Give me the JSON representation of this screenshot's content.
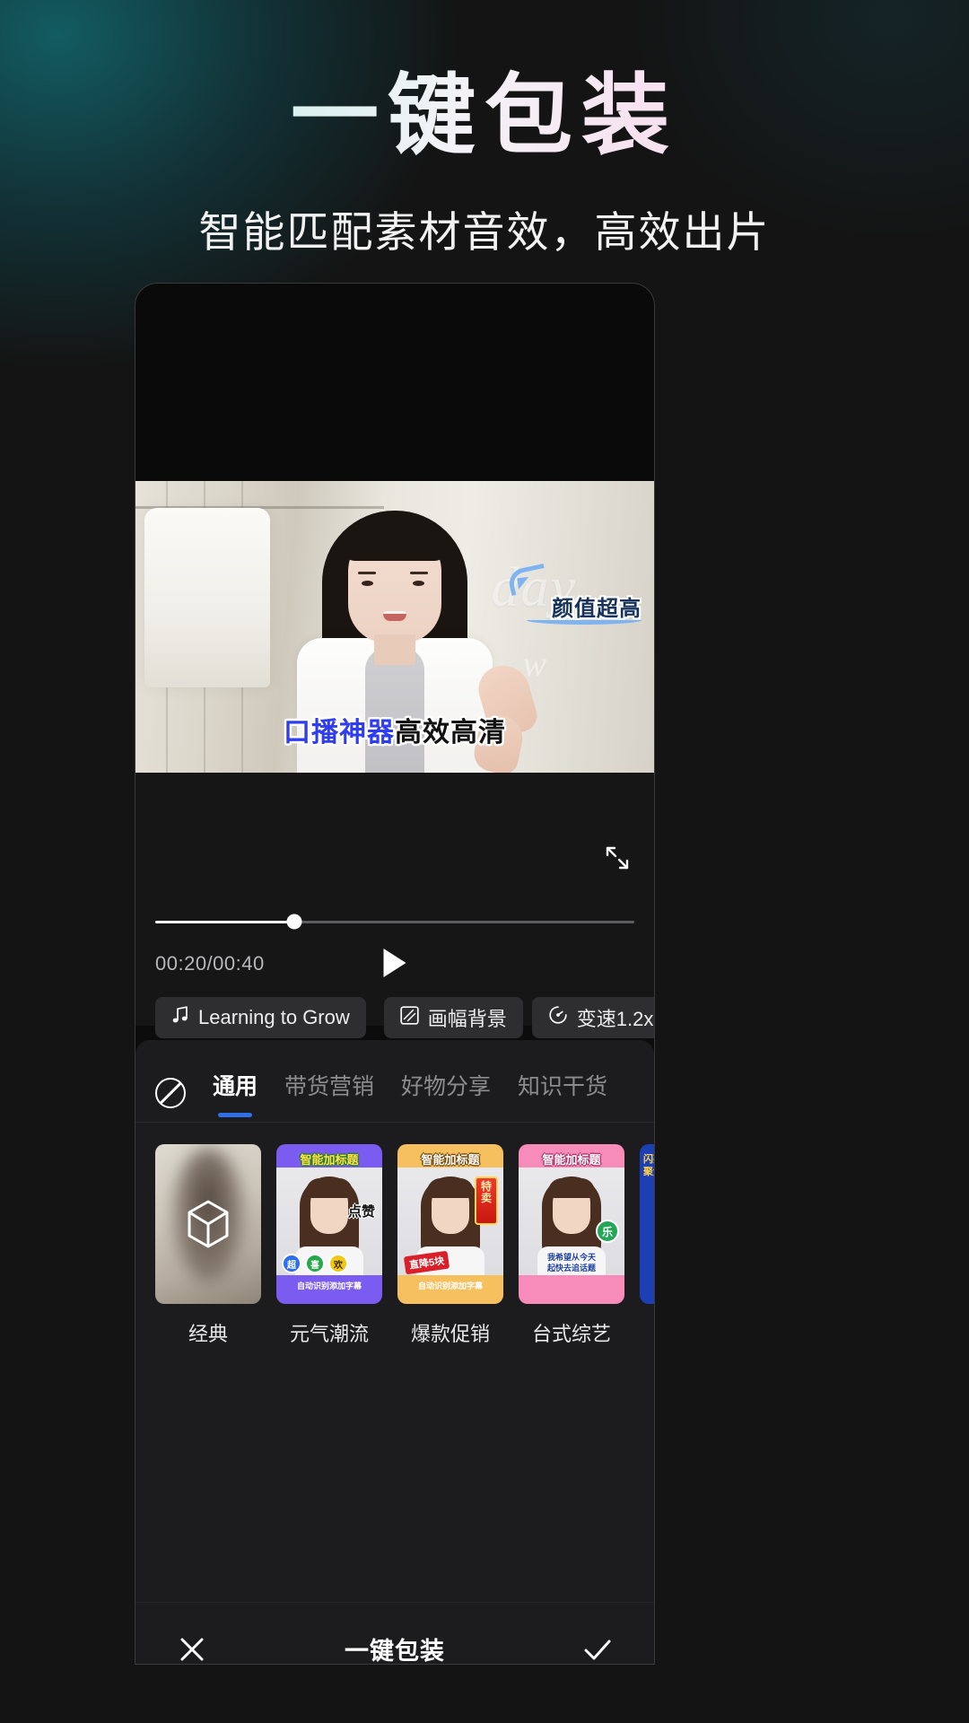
{
  "hero": {
    "title": "一键包装",
    "subtitle": "智能匹配素材音效，高效出片",
    "gradient_start": "#a8eee4",
    "gradient_end": "#f8c6e4"
  },
  "video": {
    "callout_sticker": "颜值超高",
    "subtitle_highlight": "口播神器",
    "subtitle_normal": "高效高清",
    "highlight_color": "#2f3df0",
    "watermark_1": "day",
    "watermark_2": "w"
  },
  "player": {
    "expand_icon": "expand-icon",
    "current_time": "00:20",
    "separator": "/",
    "total_time": "00:40",
    "time_display": "00:20/00:40",
    "progress_percent": 29,
    "play_icon": "play-icon",
    "chips": [
      {
        "icon": "music-note-icon",
        "label": "Learning to Grow"
      },
      {
        "icon": "aspect-ratio-icon",
        "label": "画幅背景"
      },
      {
        "icon": "speed-gauge-icon",
        "label": "变速1.2x"
      }
    ]
  },
  "panel": {
    "none_icon": "no-template-icon",
    "tabs": [
      {
        "label": "通用",
        "active": true
      },
      {
        "label": "带货营销",
        "active": false
      },
      {
        "label": "好物分享",
        "active": false
      },
      {
        "label": "知识干货",
        "active": false
      }
    ],
    "active_tab_color": "#2f6fe8",
    "templates": [
      {
        "label": "经典",
        "style": "classic",
        "top_title": "",
        "bottom_text": "",
        "overlay_icon": "cube-icon"
      },
      {
        "label": "元气潮流",
        "style": "purple",
        "bg": "#7b5cf0",
        "top_title": "智能加标题",
        "sticker_right": "点赞",
        "badges": [
          "超",
          "喜",
          "欢"
        ],
        "bottom_text": "自动识别添加字幕"
      },
      {
        "label": "爆款促销",
        "style": "orange",
        "bg": "#f7c05f",
        "top_title": "智能加标题",
        "sale_tag": "特卖",
        "price_tag": "直降5块",
        "bottom_text": "自动识别添加字幕"
      },
      {
        "label": "台式综艺",
        "style": "pink",
        "bg": "#f78cba",
        "top_title": "智能加标题",
        "badge_right": "乐",
        "lines": "我希望从今天\n起快去追话题"
      },
      {
        "label": "",
        "style": "blue",
        "bg": "#1d3fb5",
        "top_title": "",
        "side_text": "闪亮\n聚焦"
      }
    ]
  },
  "bottombar": {
    "close_icon": "close-icon",
    "title": "一键包装",
    "confirm_icon": "check-icon"
  }
}
